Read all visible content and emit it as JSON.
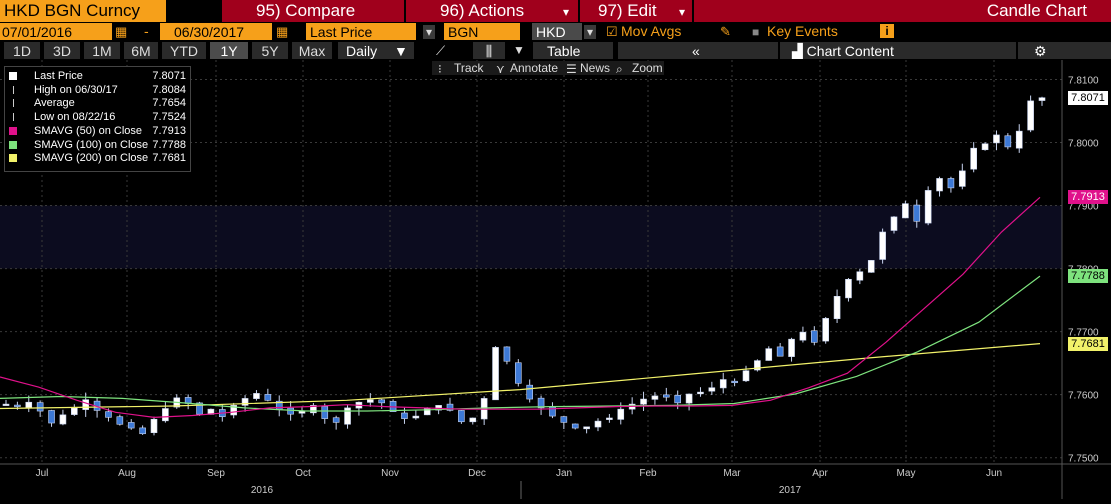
{
  "header": {
    "security": "HKD BGN Curncy",
    "compare": "95) Compare",
    "actions": "96) Actions",
    "edit": "97) Edit",
    "chart_type": "Candle Chart"
  },
  "settings": {
    "start_date": "07/01/2016",
    "dash": "-",
    "end_date": "06/30/2017",
    "field": "Last Price",
    "source": "BGN",
    "currency": "HKD",
    "mov_avgs": "Mov Avgs",
    "key_events": "Key Events"
  },
  "periods": [
    "1D",
    "3D",
    "1M",
    "6M",
    "YTD",
    "1Y",
    "5Y",
    "Max"
  ],
  "active_period": "1Y",
  "frequency": "Daily",
  "table_label": "Table",
  "chart_content_label": "Chart Content",
  "chart_toolbar": [
    "Track",
    "Annotate",
    "News",
    "Zoom"
  ],
  "legend": [
    {
      "label": "Last Price",
      "value": "7.8071",
      "color": "#ffffff"
    },
    {
      "label": "High on 06/30/17",
      "value": "7.8084",
      "color": "#cccccc"
    },
    {
      "label": "Average",
      "value": "7.7654",
      "color": "#cccccc"
    },
    {
      "label": "Low on 08/22/16",
      "value": "7.7524",
      "color": "#cccccc"
    },
    {
      "label": "SMAVG (50) on Close",
      "value": "7.7913",
      "color": "#e0118b"
    },
    {
      "label": "SMAVG (100) on Close",
      "value": "7.7788",
      "color": "#7ee37e"
    },
    {
      "label": "SMAVG (200) on Close",
      "value": "7.7681",
      "color": "#f2f26a"
    }
  ],
  "price_tags": [
    {
      "value": "7.8071",
      "bg": "#ffffff",
      "fg": "#000000"
    },
    {
      "value": "7.7913",
      "bg": "#e0118b",
      "fg": "#ffffff"
    },
    {
      "value": "7.7788",
      "bg": "#7ee37e",
      "fg": "#000000"
    },
    {
      "value": "7.7681",
      "bg": "#f2f26a",
      "fg": "#000000"
    }
  ],
  "chart_data": {
    "type": "candlestick",
    "x_labels": [
      "Jul",
      "Aug",
      "Sep",
      "Oct",
      "Nov",
      "Dec",
      "Jan",
      "Feb",
      "Mar",
      "Apr",
      "May",
      "Jun"
    ],
    "year_labels": [
      "2016",
      "2017"
    ],
    "y_ticks": [
      "7.8100",
      "7.8000",
      "7.7900",
      "7.7800",
      "7.7700",
      "7.7600",
      "7.7500"
    ],
    "ylim": [
      7.749,
      7.8115
    ],
    "close": [
      7.7585,
      7.7582,
      7.7588,
      7.7574,
      7.7555,
      7.7568,
      7.7579,
      7.7592,
      7.7575,
      7.7564,
      7.7553,
      7.7547,
      7.7538,
      7.7561,
      7.7578,
      7.7595,
      7.7586,
      7.7569,
      7.7577,
      7.7565,
      7.7583,
      7.7594,
      7.7602,
      7.7591,
      7.7576,
      7.7569,
      7.7574,
      7.7583,
      7.7562,
      7.7556,
      7.7579,
      7.7588,
      7.7592,
      7.7587,
      7.7573,
      7.7562,
      7.7566,
      7.7578,
      7.7583,
      7.7575,
      7.7557,
      7.7563,
      7.7594,
      7.7675,
      7.7653,
      7.7618,
      7.7593,
      7.7579,
      7.7566,
      7.7556,
      7.7547,
      7.7549,
      7.7558,
      7.7563,
      7.7577,
      7.7585,
      7.7593,
      7.7598,
      7.7596,
      7.7587,
      7.7601,
      7.7604,
      7.7611,
      7.7624,
      7.7619,
      7.7638,
      7.7654,
      7.7673,
      7.7661,
      7.7688,
      7.7699,
      7.7683,
      7.7721,
      7.7756,
      7.7783,
      7.7795,
      7.7813,
      7.7858,
      7.7882,
      7.7903,
      7.7875,
      7.7924,
      7.7943,
      7.7928,
      7.7955,
      7.7991,
      7.7998,
      7.8012,
      7.7993,
      7.8018,
      7.8066,
      7.8071
    ],
    "sma50": [
      7.7628,
      7.7612,
      7.7591,
      7.7572,
      7.7564,
      7.7567,
      7.7572,
      7.7579,
      7.7581,
      7.7584,
      7.7581,
      7.7579,
      7.7577,
      7.7577,
      7.7577,
      7.7579,
      7.7581,
      7.7582,
      7.7582,
      7.7583,
      7.7591,
      7.7611,
      7.7634,
      7.7683,
      7.7737,
      7.7791,
      7.7858,
      7.7913
    ],
    "sma100": [
      7.7594,
      7.7597,
      7.7594,
      7.7587,
      7.7579,
      7.7574,
      7.7574,
      7.7576,
      7.7579,
      7.7581,
      7.7582,
      7.7583,
      7.7586,
      7.7601,
      7.7629,
      7.7668,
      7.7715,
      7.7788
    ],
    "sma200": [
      7.7578,
      7.7582,
      7.7591,
      7.7608,
      7.7633,
      7.7658,
      7.7681
    ]
  }
}
